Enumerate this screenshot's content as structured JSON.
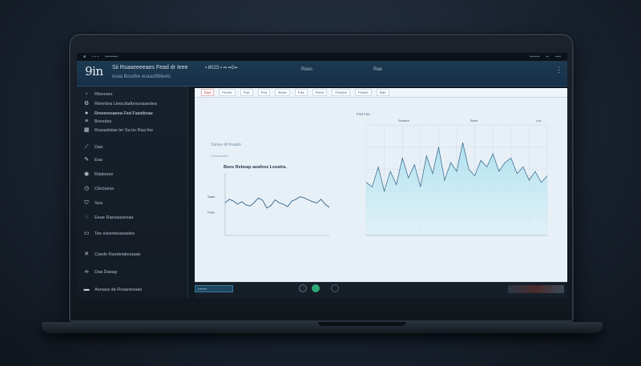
{
  "system_bar": {
    "left_items": [
      "■",
      "▪ ▪ ▪",
      "▪▪▪▪▪▪▪▪▪"
    ],
    "right_items": [
      "▪▪▪▪▪▪▪",
      "▪▪",
      "▪▪▪▪"
    ]
  },
  "header": {
    "logo": "9in",
    "title": "Sii  Rsaaeeeeaes Fead dr Ieee",
    "subtitle": "esaa   Bosdbe ecaastfdlleelz",
    "numbers": "▪ 8023  ▪    ▪▪ ▪▪2▪▪",
    "link_1": "Rees",
    "link_2": "Rae",
    "more_icon": "⋮"
  },
  "sidebar": {
    "items": [
      {
        "label": "Rfeerees",
        "icon": "square-icon"
      },
      {
        "label": "Rleenbra Ueisclladtesceaaedea",
        "icon": "gear-icon"
      },
      {
        "label": "Rreeeresaeea Fed Fassiboae",
        "icon": "user-icon"
      },
      {
        "label": "Boesdss",
        "icon": "bars-icon"
      },
      {
        "label": "Rrasadrdae ler Sa ler Raa fee",
        "icon": "grid-icon"
      },
      {
        "label": "Daa",
        "icon": "chart-icon"
      },
      {
        "label": "Eaa",
        "icon": "pen-icon"
      },
      {
        "label": "Rdaleeze",
        "icon": "bell-icon"
      },
      {
        "label": "Cfeclaess",
        "icon": "clock-icon"
      },
      {
        "label": "Sea",
        "icon": "shield-icon"
      },
      {
        "label": "Eeae Raesaaseeaa",
        "icon": "headset-icon"
      },
      {
        "label": "Tee elsanteeasaslee",
        "icon": "folder-icon"
      },
      {
        "label": "Caeds Raedelaleoaaae",
        "icon": "tool-icon"
      },
      {
        "label": "Daa Daaag",
        "icon": "link-icon"
      },
      {
        "label": "Aeeaea da Rsaaneeaae",
        "icon": "settings-icon"
      }
    ]
  },
  "toolbar": {
    "items": [
      "Ead",
      "Feeee",
      "Faa",
      "Fea",
      "Beae",
      "Faa",
      "Reee",
      "Fassee",
      "Feaee",
      "Bae"
    ]
  },
  "chart_left": {
    "title": "Sanea dd feaade",
    "subtitle": "Faaeaeeaee",
    "heading": "Bees  Rebeap aeafese Leeatra.",
    "legend_labels": [
      "Saae",
      "Fabe"
    ]
  },
  "chart_right": {
    "legend": "Fad  Fae",
    "top_labels": [
      "Seaaee",
      "Beee"
    ],
    "corner_label": "Lsd"
  },
  "chart_data": [
    {
      "type": "line",
      "title": "",
      "xlabel": "",
      "ylabel": "",
      "x": [
        0,
        2,
        4,
        6,
        8,
        10,
        12,
        14,
        16,
        18,
        20,
        22,
        24,
        26,
        28,
        30,
        32,
        34,
        36,
        38,
        40,
        42,
        44,
        46,
        48,
        50
      ],
      "series": [
        {
          "values": [
            52,
            58,
            55,
            50,
            54,
            49,
            47,
            53,
            60,
            56,
            44,
            48,
            57,
            52,
            50,
            46,
            55,
            58,
            62,
            60,
            57,
            54,
            52,
            58,
            50,
            45
          ]
        }
      ],
      "ylim": [
        0,
        100
      ],
      "grid": false
    },
    {
      "type": "area",
      "title": "",
      "xlabel": "",
      "ylabel": "",
      "x": [
        0,
        2,
        4,
        6,
        8,
        10,
        12,
        14,
        16,
        18,
        20,
        22,
        24,
        26,
        28,
        30,
        32,
        34,
        36,
        38,
        40,
        42,
        44,
        46,
        48,
        50,
        52,
        54,
        56,
        58,
        60
      ],
      "series": [
        {
          "values": [
            48,
            44,
            62,
            40,
            58,
            46,
            70,
            52,
            64,
            44,
            72,
            56,
            80,
            50,
            66,
            58,
            84,
            60,
            54,
            68,
            62,
            74,
            58,
            66,
            70,
            56,
            62,
            50,
            58,
            48,
            54
          ]
        }
      ],
      "ylim": [
        0,
        100
      ],
      "grid": true
    }
  ],
  "bottom_bar": {
    "input_value": "▪▪▪▪▪▪▪▪",
    "buttons": [
      "record-button",
      "play-button",
      "stop-button"
    ]
  },
  "colors": {
    "header": "#1d3a50",
    "sidebar": "#17202b",
    "content": "#e8f0f7",
    "line_left": "#2f5f86",
    "line_right": "#2f5f86",
    "area_right": "#a8dfee",
    "accent_green": "#2ea87a"
  }
}
